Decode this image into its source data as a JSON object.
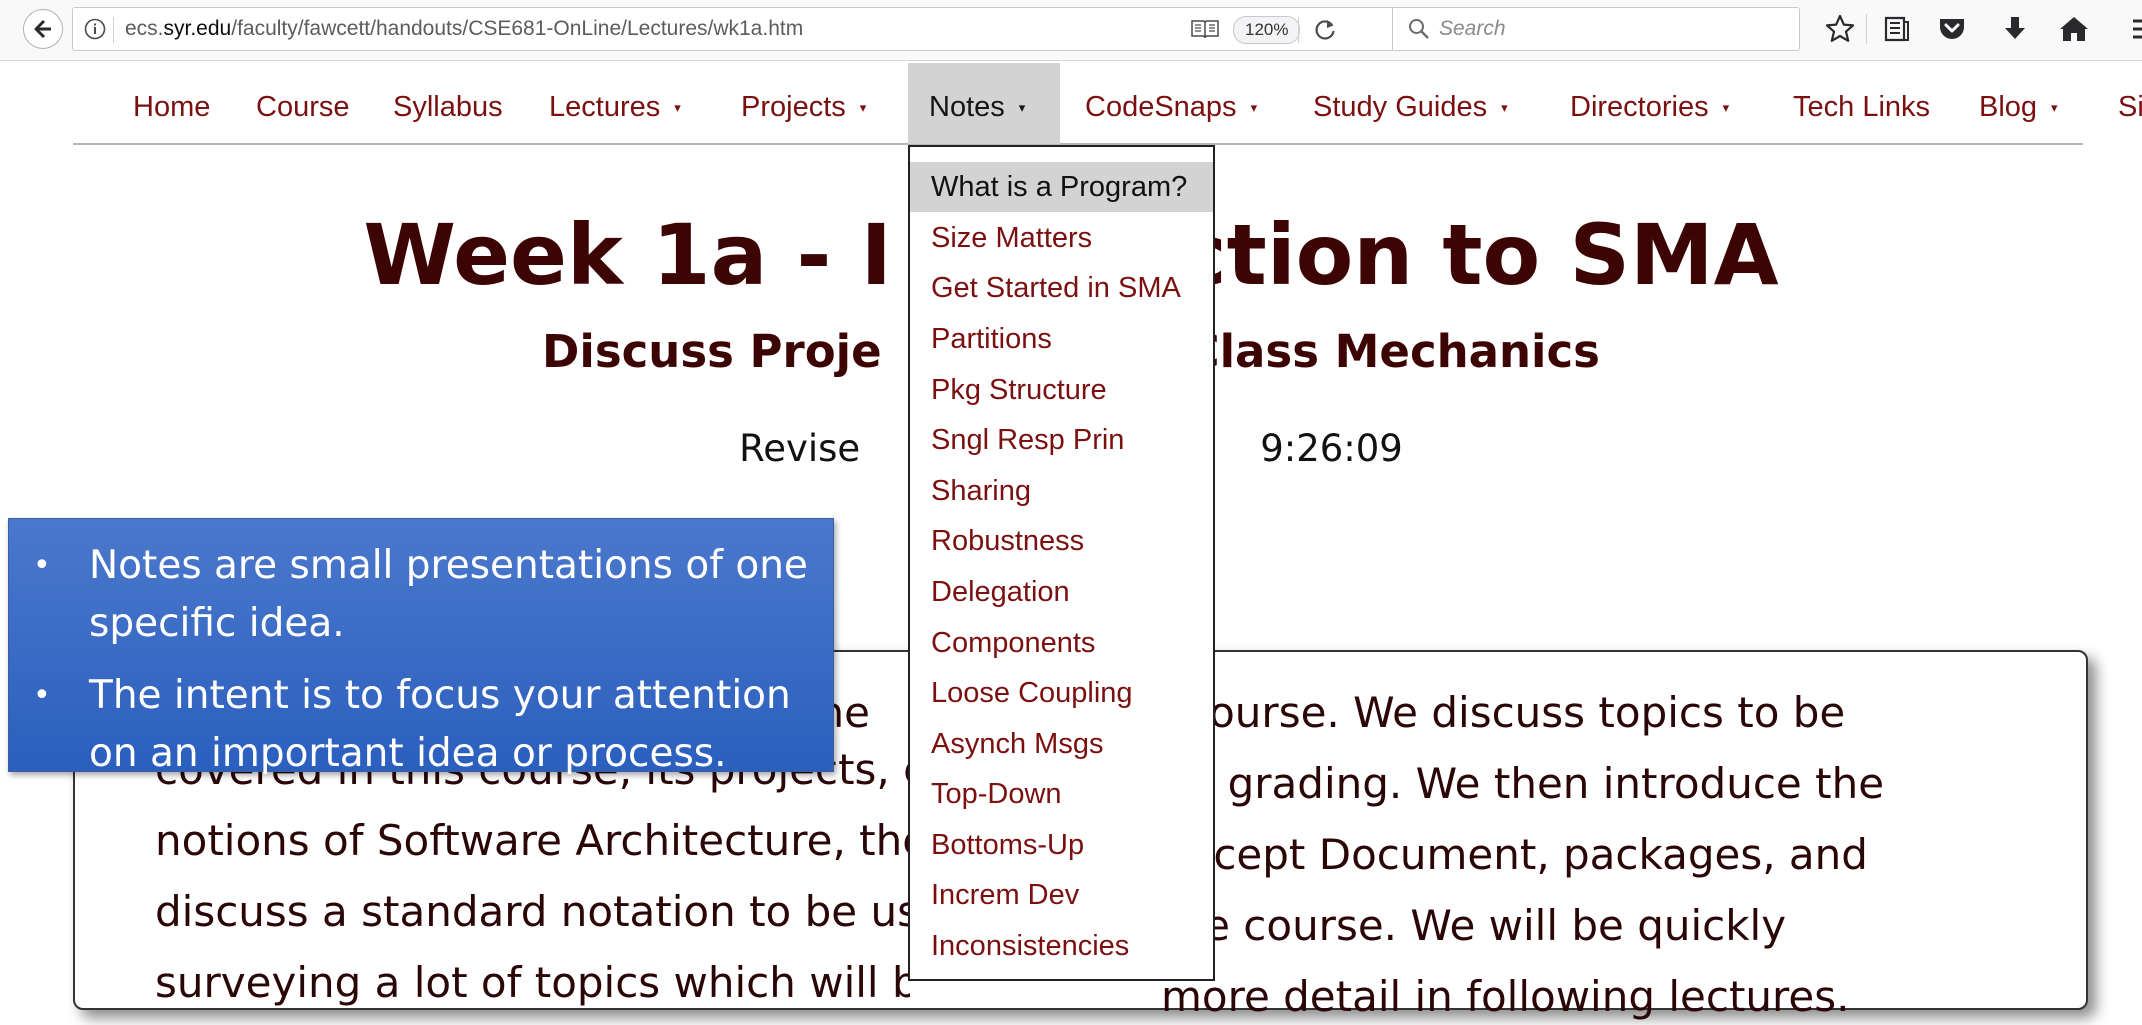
{
  "browser": {
    "url_prefix": "ecs.",
    "url_domain": "syr.edu",
    "url_path": "/faculty/fawcett/handouts/CSE681-OnLine/Lectures/wk1a.htm",
    "zoom": "120%",
    "search_placeholder": "Search",
    "icons": [
      "back-arrow-icon",
      "info-icon",
      "reader-view-icon",
      "reload-icon",
      "search-icon",
      "bookmark-star-icon",
      "reading-list-icon",
      "pocket-icon",
      "download-icon",
      "home-icon",
      "menu-icon"
    ]
  },
  "nav": {
    "items": [
      {
        "label": "Home"
      },
      {
        "label": "Course"
      },
      {
        "label": "Syllabus"
      },
      {
        "label": "Lectures",
        "caret": "▾"
      },
      {
        "label": "Projects",
        "caret": "▾"
      },
      {
        "label": "Notes",
        "caret": "▾",
        "active": true
      },
      {
        "label": "CodeSnaps",
        "caret": "▾"
      },
      {
        "label": "Study Guides",
        "caret": "▾"
      },
      {
        "label": "Directories",
        "caret": "▾"
      },
      {
        "label": "Tech Links"
      },
      {
        "label": "Blog",
        "caret": "▾"
      },
      {
        "label": "Si"
      }
    ]
  },
  "notes_menu": {
    "items": [
      "What is a Program?",
      "Size Matters",
      "Get Started in SMA",
      "Partitions",
      "Pkg Structure",
      "Sngl Resp Prin",
      "Sharing",
      "Robustness",
      "Delegation",
      "Components",
      "Loose Coupling",
      "Asynch Msgs",
      "Top-Down",
      "Bottoms-Up",
      "Increm Dev",
      "Inconsistencies"
    ]
  },
  "page": {
    "title_left": "Week 1a - I",
    "title_right": "ction to SMA",
    "subtitle_left": "Discuss Proje",
    "subtitle_right": "Class Mechanics",
    "revised_left": "Revise",
    "revised_right": "9:26:09",
    "intro_lines": [
      [
        "",
        "the",
        "l course. We discuss topics to be"
      ],
      [
        "covered in this course, its projects, e",
        "",
        "nd grading. We then introduce the"
      ],
      [
        "notions of Software Architecture, the",
        "",
        "oncept Document, packages, and"
      ],
      [
        "discuss a standard notation to be us",
        "",
        "the course. We will be quickly"
      ],
      [
        "surveying a lot of topics which will b",
        "",
        "more detail in following lectures."
      ]
    ]
  },
  "callout": {
    "bullet": "•",
    "points": [
      "Notes are small presentations of one specific idea.",
      "The intent is to focus your attention on an important idea or process."
    ]
  },
  "colors": {
    "link": "#7b1010",
    "heading": "#3d0404",
    "callout_bg": "#3a6bc6",
    "menu_highlight": "#d3d3d3"
  }
}
